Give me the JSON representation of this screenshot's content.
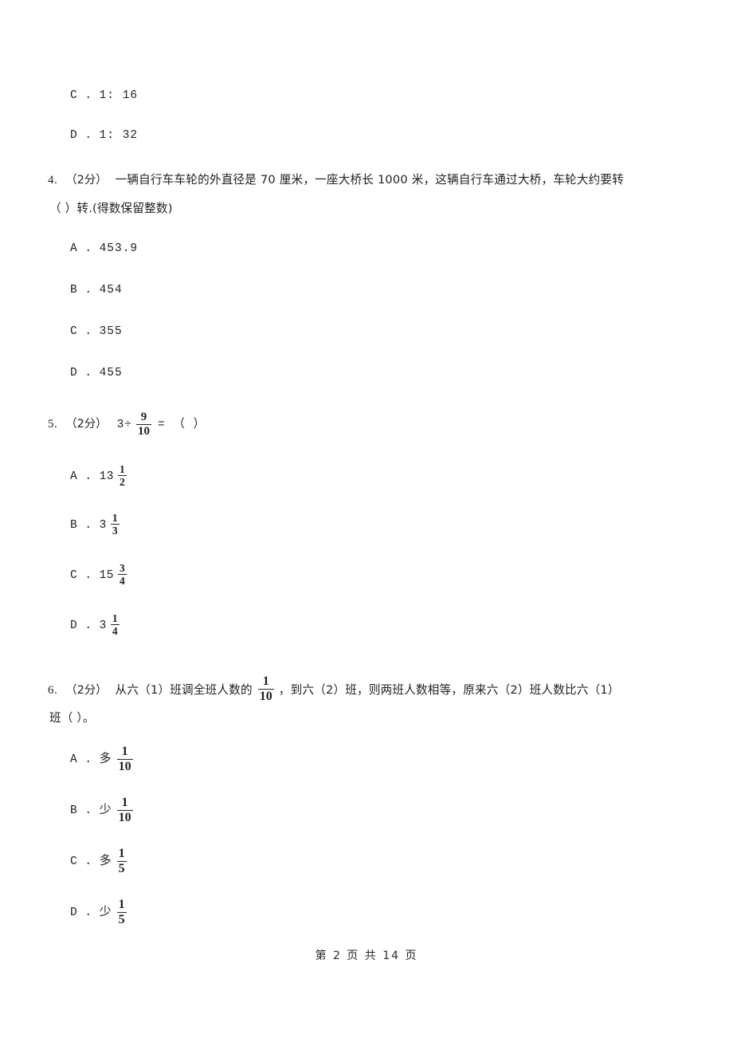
{
  "document": {
    "page_footer": "第 2 页  共 14 页",
    "page_number": "2",
    "total_pages": "14"
  },
  "carryover_options": [
    {
      "letter": "C .",
      "value": "1: 16"
    },
    {
      "letter": "D .",
      "value": "1: 32"
    }
  ],
  "questions": [
    {
      "number": "4.",
      "marks": "（2分）",
      "text_line1": "一辆自行车车轮的外直径是 70 厘米，一座大桥长 1000 米，这辆自行车通过大桥，车轮大约要转",
      "text_line2": "（      ）转.(得数保留整数)",
      "options": [
        {
          "letter": "A .",
          "value": "453.9"
        },
        {
          "letter": "B .",
          "value": "454"
        },
        {
          "letter": "C .",
          "value": "355"
        },
        {
          "letter": "D .",
          "value": "455"
        }
      ]
    },
    {
      "number": "5.",
      "marks": "（2分）",
      "expr_lead": "3÷",
      "expr_frac_num": "9",
      "expr_frac_den": "10",
      "expr_tail": "= （      ）",
      "options": [
        {
          "letter": "A .",
          "whole": "13",
          "num": "1",
          "den": "2"
        },
        {
          "letter": "B .",
          "whole": "3",
          "num": "1",
          "den": "3"
        },
        {
          "letter": "C .",
          "whole": "15",
          "num": "3",
          "den": "4"
        },
        {
          "letter": "D .",
          "whole": "3",
          "num": "1",
          "den": "4"
        }
      ]
    },
    {
      "number": "6.",
      "marks": "（2分）",
      "text_a": "从六（1）班调全班人数的",
      "frac_num": "1",
      "frac_den": "10",
      "text_b": "，到六（2）班，则两班人数相等，原来六（2）班人数比六（1）",
      "text_line2": "班（      ）。",
      "options": [
        {
          "letter": "A .",
          "word": "多",
          "num": "1",
          "den": "10"
        },
        {
          "letter": "B .",
          "word": "少",
          "num": "1",
          "den": "10"
        },
        {
          "letter": "C .",
          "word": "多",
          "num": "1",
          "den": "5"
        },
        {
          "letter": "D .",
          "word": "少",
          "num": "1",
          "den": "5"
        }
      ]
    }
  ]
}
